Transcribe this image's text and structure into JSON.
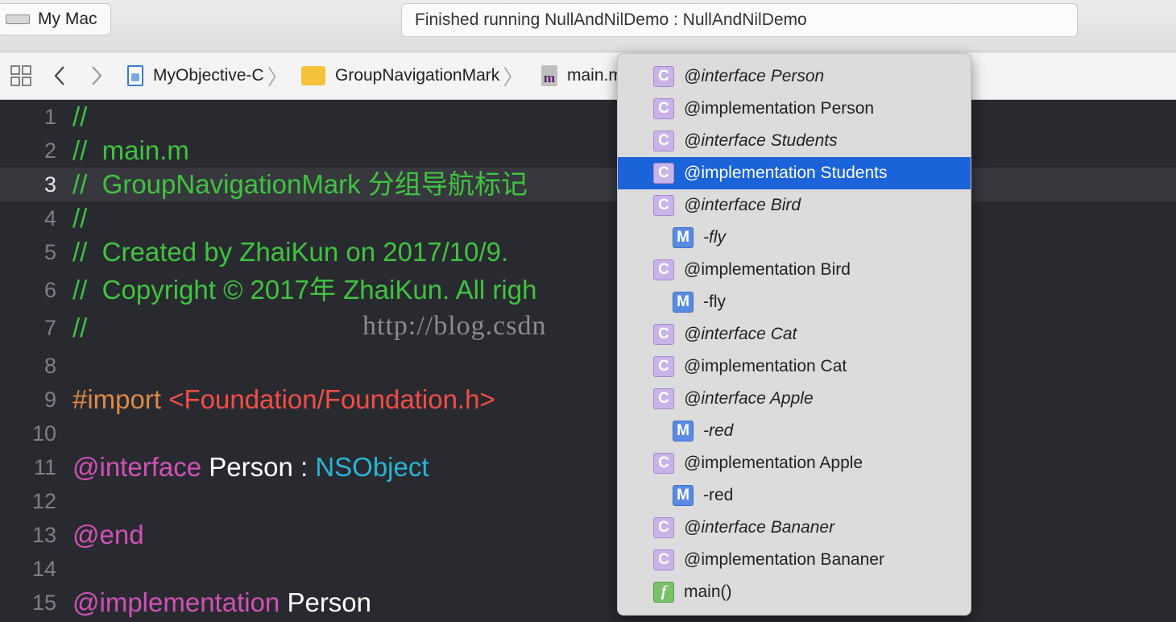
{
  "toolbar": {
    "scheme_label": "My Mac",
    "status_text": "Finished running NullAndNilDemo : NullAndNilDemo"
  },
  "jumpbar": {
    "crumbs": [
      "MyObjective-C",
      "GroupNavigationMark",
      "main.m"
    ]
  },
  "editor": {
    "lines": [
      {
        "n": "1"
      },
      {
        "n": "2"
      },
      {
        "n": "3"
      },
      {
        "n": "4"
      },
      {
        "n": "5"
      },
      {
        "n": "6"
      },
      {
        "n": "7"
      },
      {
        "n": "8"
      },
      {
        "n": "9"
      },
      {
        "n": "10"
      },
      {
        "n": "11"
      },
      {
        "n": "12"
      },
      {
        "n": "13"
      },
      {
        "n": "14"
      },
      {
        "n": "15"
      }
    ],
    "code": {
      "l1": "//",
      "l2": "//  main.m",
      "l3": "//  GroupNavigationMark 分组导航标记",
      "l4": "//",
      "l5": "//  Created by ZhaiKun on 2017/10/9.",
      "l6": "//  Copyright © 2017年 ZhaiKun. All righ",
      "l7": "//",
      "l9_directive": "#import",
      "l9_path": "<Foundation/Foundation.h>",
      "l11_kw": "@interface",
      "l11_name": " Person : ",
      "l11_type": "NSObject",
      "l13_kw": "@end",
      "l15_kw": "@implementation",
      "l15_name": " Person"
    },
    "watermark": "http://blog.csdn"
  },
  "menu": {
    "selected_index": 3,
    "items": [
      {
        "badge": "C",
        "label": "@interface Person",
        "italic": true
      },
      {
        "badge": "C",
        "label": "@implementation Person",
        "italic": false
      },
      {
        "badge": "C",
        "label": "@interface Students",
        "italic": true
      },
      {
        "badge": "C",
        "label": "@implementation Students",
        "italic": false
      },
      {
        "badge": "C",
        "label": "@interface Bird",
        "italic": true
      },
      {
        "badge": "M",
        "label": "-fly",
        "italic": true
      },
      {
        "badge": "C",
        "label": "@implementation Bird",
        "italic": false
      },
      {
        "badge": "M",
        "label": "-fly",
        "italic": false
      },
      {
        "badge": "C",
        "label": "@interface Cat",
        "italic": true
      },
      {
        "badge": "C",
        "label": "@implementation Cat",
        "italic": false
      },
      {
        "badge": "C",
        "label": "@interface Apple",
        "italic": true
      },
      {
        "badge": "M",
        "label": "-red",
        "italic": true
      },
      {
        "badge": "C",
        "label": "@implementation Apple",
        "italic": false
      },
      {
        "badge": "M",
        "label": "-red",
        "italic": false
      },
      {
        "badge": "C",
        "label": "@interface Bananer",
        "italic": true
      },
      {
        "badge": "C",
        "label": "@implementation Bananer",
        "italic": false
      },
      {
        "badge": "f",
        "label": "main()",
        "italic": false
      }
    ]
  },
  "colors": {
    "comment": "#40c33f",
    "keyword": "#d052b5",
    "string": "#f24d45",
    "type": "#29b5d2",
    "preprocessor": "#e08946",
    "selection": "#1b63d9"
  }
}
